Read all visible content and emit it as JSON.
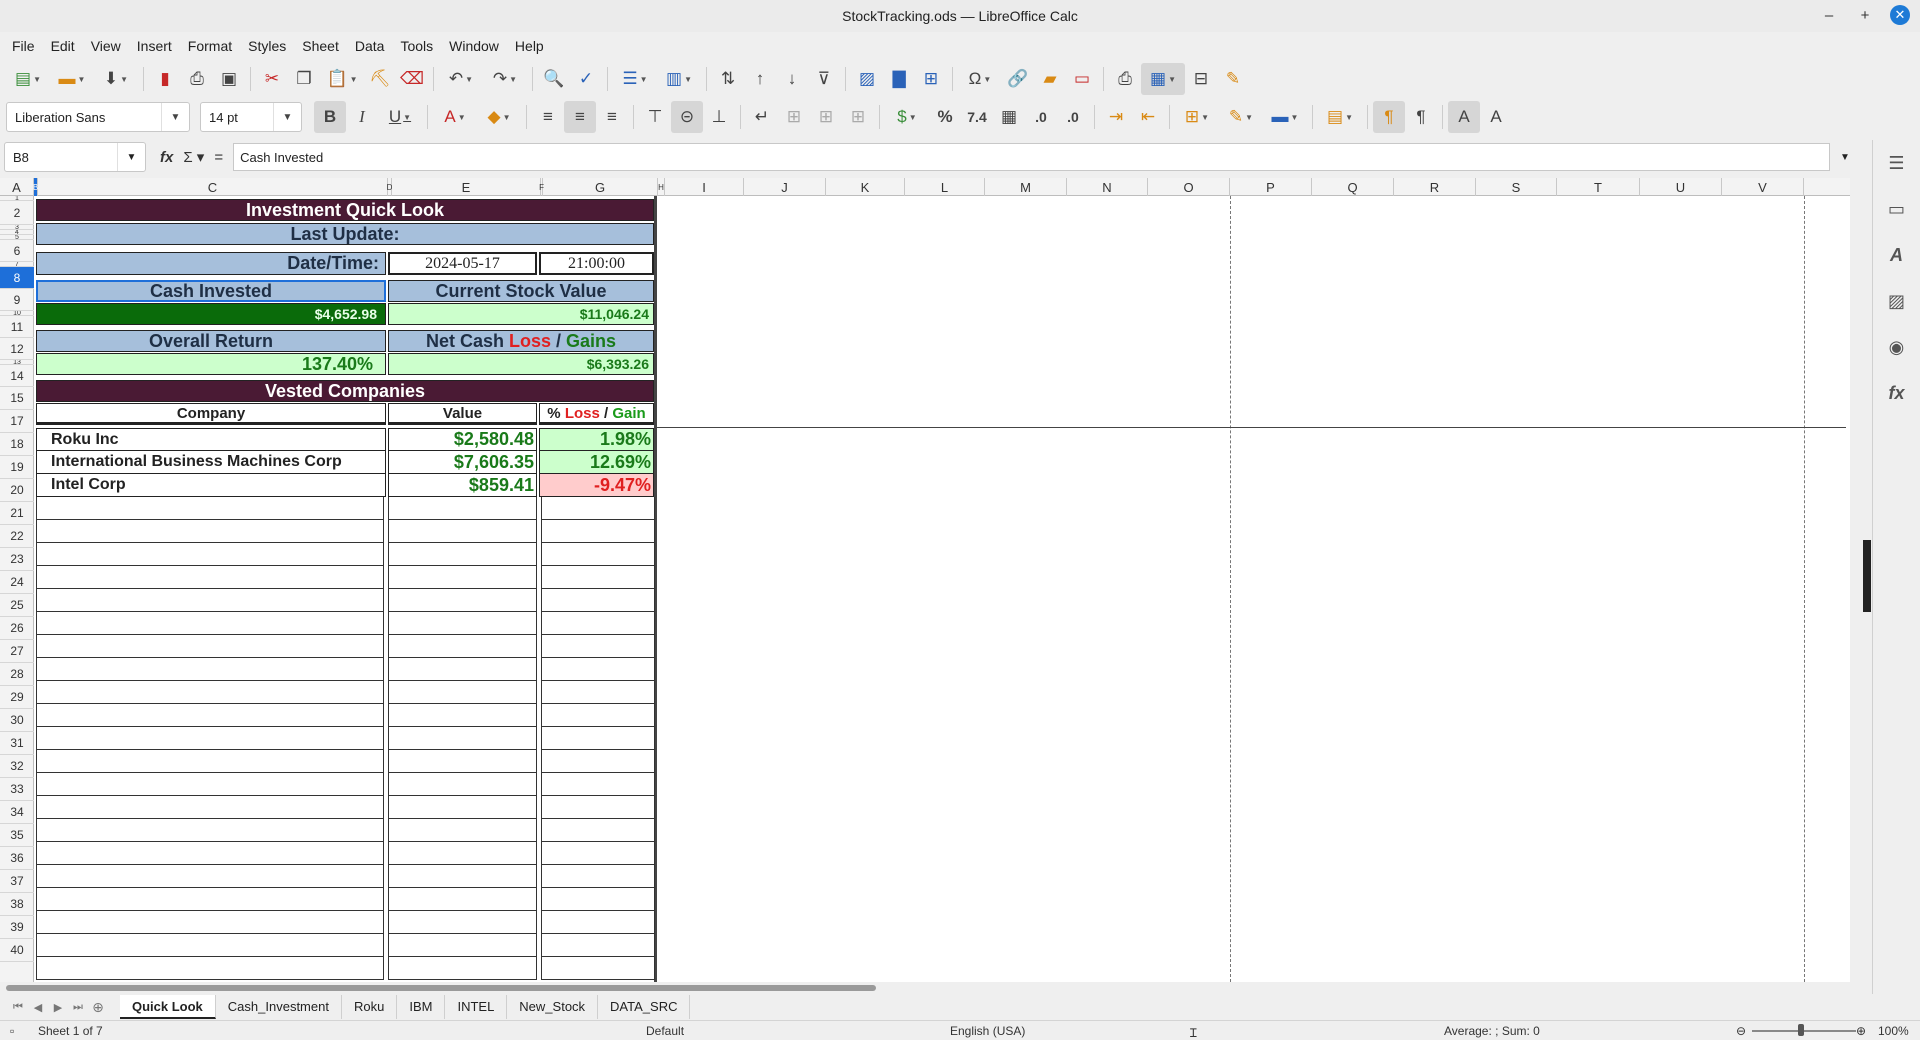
{
  "window": {
    "title": "StockTracking.ods — LibreOffice Calc",
    "controls": {
      "minimize": "–",
      "maximize": "+",
      "close": "✕"
    }
  },
  "menu": [
    "File",
    "Edit",
    "View",
    "Insert",
    "Format",
    "Styles",
    "Sheet",
    "Data",
    "Tools",
    "Window",
    "Help"
  ],
  "toolbar": {
    "font_name": "Liberation Sans",
    "font_size": "14 pt"
  },
  "formula_bar": {
    "cell_ref": "B8",
    "content": "Cash Invested"
  },
  "columns": [
    "A",
    "B",
    "C",
    "D",
    "E",
    "F",
    "G",
    "H",
    "I",
    "J",
    "K",
    "L",
    "M",
    "N",
    "O",
    "P",
    "Q",
    "R",
    "S",
    "T",
    "U",
    "V"
  ],
  "rows": [
    "1",
    "2",
    "3",
    "4",
    "5",
    "6",
    "7",
    "8",
    "9",
    "10",
    "11",
    "12",
    "13",
    "14",
    "15",
    "17",
    "18",
    "19",
    "20",
    "21",
    "22",
    "23",
    "24",
    "25",
    "26",
    "27",
    "28",
    "29",
    "30",
    "31",
    "32",
    "33",
    "34",
    "35",
    "36",
    "37",
    "38",
    "39",
    "40"
  ],
  "sheet": {
    "title": "Investment Quick Look",
    "last_update_label": "Last Update:",
    "datetime_label": "Date/Time:",
    "date": "2024-05-17",
    "time": "21:00:00",
    "cash_invested_label": "Cash Invested",
    "cash_invested_value": "$4,652.98",
    "current_value_label": "Current Stock Value",
    "current_value": "$11,046.24",
    "overall_return_label": "Overall Return",
    "overall_return_value": "137.40%",
    "net_cash_prefix": "Net Cash ",
    "net_cash_loss": "Loss",
    "net_cash_sep": " / ",
    "net_cash_gains": "Gains",
    "net_cash_value": "$6,393.26",
    "vested_title": "Vested Companies",
    "col_company": "Company",
    "col_value": "Value",
    "col_pct_prefix": "% ",
    "col_pct_loss": "Loss",
    "col_pct_sep": " / ",
    "col_pct_gain": "Gain",
    "companies": [
      {
        "name": "Roku Inc",
        "value": "$2,580.48",
        "pct": "1.98%"
      },
      {
        "name": "International Business Machines Corp",
        "value": "$7,606.35",
        "pct": "12.69%"
      },
      {
        "name": "Intel Corp",
        "value": "$859.41",
        "pct": "-9.47%"
      }
    ]
  },
  "colors": {
    "title_bg": "#4a1a34",
    "header_bg": "#a6bfdb",
    "cash_bg": "#0a6b0a",
    "green_bg": "#ccffcc",
    "red_bg": "#ffcccc",
    "green_text": "#1a7a1a",
    "red_text": "#e02020",
    "selection": "#1e6fd9"
  },
  "tabs": [
    "Quick Look",
    "Cash_Investment",
    "Roku",
    "IBM",
    "INTEL",
    "New_Stock",
    "DATA_SRC"
  ],
  "status": {
    "sheet": "Sheet 1 of 7",
    "style": "Default",
    "language": "English (USA)",
    "summary": "Average: ; Sum: 0",
    "zoom": "100%"
  }
}
